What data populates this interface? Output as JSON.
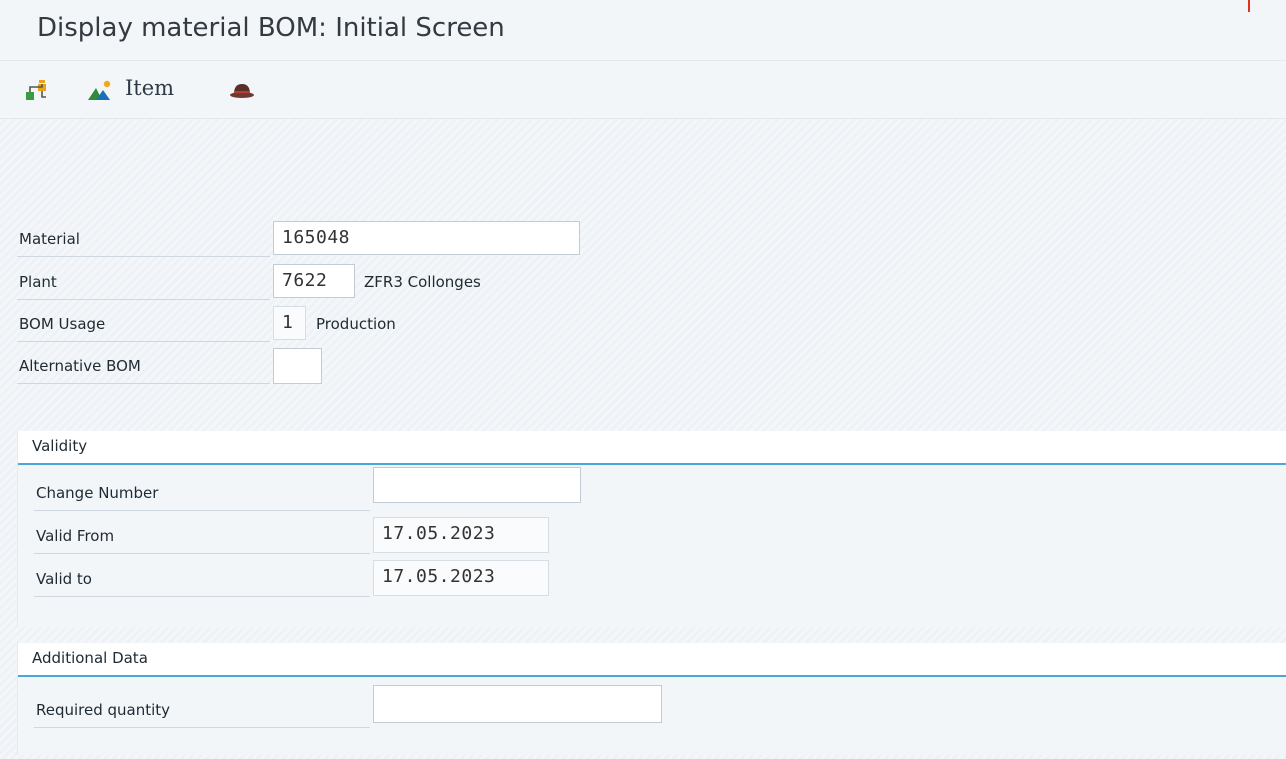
{
  "window": {
    "title": "Display material BOM: Initial Screen"
  },
  "toolbar": {
    "items": [
      {
        "icon": "hierarchy-icon"
      },
      {
        "icon": "item-icon",
        "label": "Item"
      },
      {
        "icon": "hat-icon"
      }
    ]
  },
  "form": {
    "material": {
      "label": "Material",
      "value": "165048"
    },
    "plant": {
      "label": "Plant",
      "value": "7622",
      "description": "ZFR3 Collonges"
    },
    "bom_usage": {
      "label": "BOM Usage",
      "value": "1",
      "description": "Production"
    },
    "alternative_bom": {
      "label": "Alternative BOM",
      "value": ""
    }
  },
  "validity": {
    "title": "Validity",
    "change_number": {
      "label": "Change Number",
      "value": ""
    },
    "valid_from": {
      "label": "Valid From",
      "value": "17.05.2023"
    },
    "valid_to": {
      "label": "Valid to",
      "value": "17.05.2023"
    }
  },
  "additional_data": {
    "title": "Additional Data",
    "required_quantity": {
      "label": "Required quantity",
      "value": ""
    }
  },
  "colors": {
    "accent": "#4ba6d9",
    "background": "#f2f5f8"
  }
}
